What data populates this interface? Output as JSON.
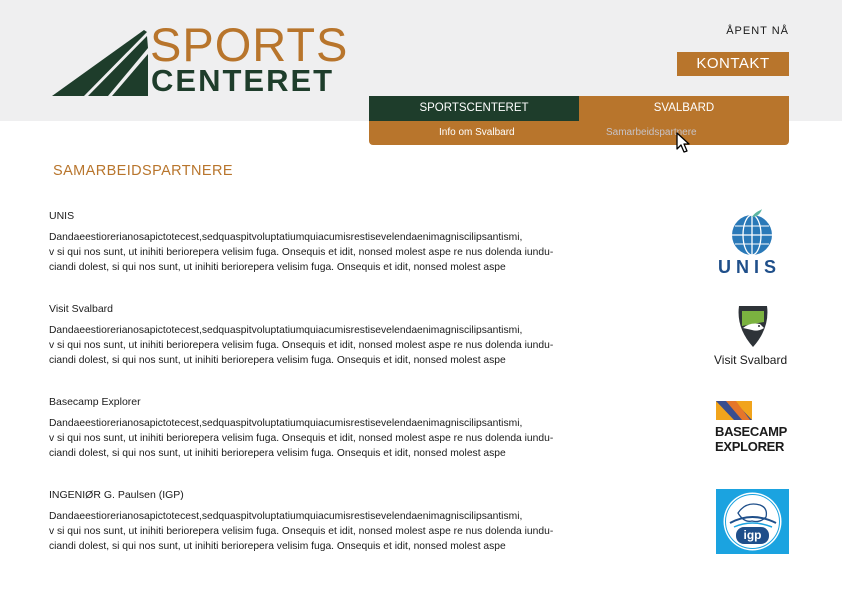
{
  "brand": {
    "word1": "SPORTS",
    "word2": "CENTERET"
  },
  "header": {
    "open_now": "ÅPENT NÅ",
    "contact_label": "KONTAKT"
  },
  "nav": {
    "tabs": [
      {
        "label": "SPORTSCENTERET"
      },
      {
        "label": "SVALBARD"
      }
    ],
    "subitems": [
      {
        "label": "Info om Svalbard"
      },
      {
        "label": "Samarbeidspartnere"
      }
    ]
  },
  "page": {
    "title": "SAMARBEIDSPARTNERE"
  },
  "partners": [
    {
      "name": "UNIS",
      "lines": [
        "Dandaeestiorerianosapictotecest,sedquaspitvoluptatiumquiacumisrestisevelendaenimagniscilipsantismi,",
        "v si qui nos sunt, ut inihiti beriorepera velisim fuga. Onsequis et idit, nonsed molest aspe re nus dolenda iundu-",
        "ciandi dolest, si qui nos sunt, ut inihiti beriorepera velisim fuga. Onsequis et idit, nonsed molest aspe"
      ],
      "logo_text": "UNIS"
    },
    {
      "name": "Visit Svalbard",
      "lines": [
        "Dandaeestiorerianosapictotecest,sedquaspitvoluptatiumquiacumisrestisevelendaenimagniscilipsantismi,",
        "v si qui nos sunt, ut inihiti beriorepera velisim fuga. Onsequis et idit, nonsed molest aspe re nus dolenda iundu-",
        "ciandi dolest, si qui nos sunt, ut inihiti beriorepera velisim fuga. Onsequis et idit, nonsed molest aspe"
      ],
      "logo_text": "Visit Svalbard"
    },
    {
      "name": "Basecamp Explorer",
      "lines": [
        "Dandaeestiorerianosapictotecest,sedquaspitvoluptatiumquiacumisrestisevelendaenimagniscilipsantismi,",
        "v si qui nos sunt, ut inihiti beriorepera velisim fuga. Onsequis et idit, nonsed molest aspe re nus dolenda iundu-",
        "ciandi dolest, si qui nos sunt, ut inihiti beriorepera velisim fuga. Onsequis et idit, nonsed molest aspe"
      ],
      "logo_text": [
        "BASECAMP",
        "EXPLORER"
      ]
    },
    {
      "name": "INGENIØR G. Paulsen (IGP)",
      "lines": [
        "Dandaeestiorerianosapictotecest,sedquaspitvoluptatiumquiacumisrestisevelendaenimagniscilipsantismi,",
        "v si qui nos sunt, ut inihiti beriorepera velisim fuga. Onsequis et idit, nonsed molest aspe re nus dolenda iundu-",
        "ciandi dolest, si qui nos sunt, ut inihiti beriorepera velisim fuga. Onsequis et idit, nonsed molest aspe"
      ],
      "logo_text": "igp"
    }
  ],
  "colors": {
    "brand_gold": "#b8752c",
    "brand_green": "#1e3d2b",
    "header_bg": "#efeff0"
  },
  "icons": {
    "cursor": "arrow-cursor-icon"
  }
}
